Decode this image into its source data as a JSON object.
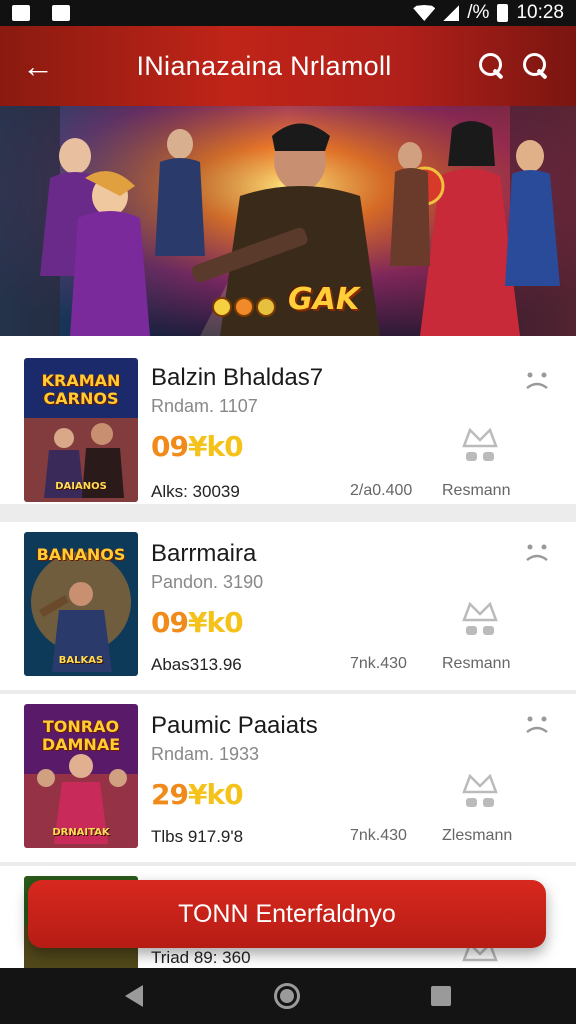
{
  "status_bar": {
    "time": "10:28",
    "battery": "/%"
  },
  "app_bar": {
    "back_icon": "arrow-left-icon",
    "title": "INianazaina Nrlamoll",
    "search_icon": "search-icon",
    "search2_icon": "search-icon"
  },
  "hero": {
    "logo_text": "GAK"
  },
  "cards": [
    {
      "thumb_title": "KRAMAN CARNOS",
      "thumb_footer": "DAIANOS",
      "name": "Balzin Bhaldas7",
      "sub": "Rndam. 1107",
      "score_a": "09",
      "score_b": "¥k0",
      "meta1": "Alks: 30039",
      "meta2": "2/a0.400",
      "meta3": "Resmann",
      "thumb_colors": [
        "#1a2a6a",
        "#d84a1a"
      ]
    },
    {
      "thumb_title": "BANANOS",
      "thumb_footer": "BALKAS",
      "name": "Barrmaira",
      "sub": "Pandon. 3190",
      "score_a": "09",
      "score_b": "¥k0",
      "meta1": "Abas313.96",
      "meta2": "7nk.430",
      "meta3": "Resmann",
      "thumb_colors": [
        "#0e3a5a",
        "#e88a1a"
      ]
    },
    {
      "thumb_title": "TONRAO DAMNAE",
      "thumb_footer": "DRNAITAK",
      "name": "Paumic Paaiats",
      "sub": "Rndam. 1933",
      "score_a": "29",
      "score_b": "¥k0",
      "meta1": "Tlbs 917.9'8",
      "meta2": "7nk.430",
      "meta3": "Zlesmann",
      "thumb_colors": [
        "#5a1a6a",
        "#e0501a"
      ]
    },
    {
      "thumb_title": "",
      "thumb_footer": "",
      "name": "",
      "sub": "",
      "score_a": "",
      "score_b": "",
      "meta1": "Triad 89: 360",
      "meta2": "",
      "meta3": "",
      "thumb_colors": [
        "#2a5a1a",
        "#6a3a1a"
      ]
    }
  ],
  "cta": {
    "label": "TONN Enterfaldnyo"
  },
  "nav": {
    "back_icon": "nav-back-icon",
    "home_icon": "nav-home-icon",
    "recents_icon": "nav-recents-icon"
  }
}
